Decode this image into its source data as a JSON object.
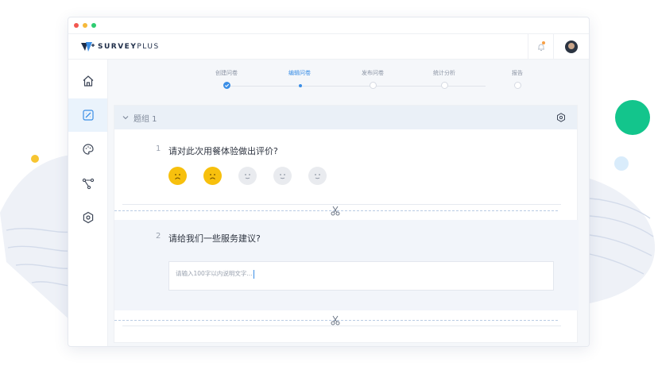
{
  "app": {
    "logo_text": "SURVEY",
    "logo_plus": "PLUS"
  },
  "colors": {
    "accent": "#3a8ee6",
    "face_active": "#f7c00d",
    "decor_green": "#13c58c",
    "decor_yellow": "#f7c531"
  },
  "sidebar": {
    "items": [
      {
        "icon": "home-icon"
      },
      {
        "icon": "edit-survey-icon",
        "active": true
      },
      {
        "icon": "palette-icon"
      },
      {
        "icon": "flow-icon"
      },
      {
        "icon": "settings-icon"
      }
    ]
  },
  "steps": [
    {
      "label": "创建问卷",
      "state": "done"
    },
    {
      "label": "编辑问卷",
      "state": "current"
    },
    {
      "label": "发布问卷",
      "state": "todo"
    },
    {
      "label": "统计分析",
      "state": "todo"
    },
    {
      "label": "报告",
      "state": "todo"
    }
  ],
  "group": {
    "title": "题组 1"
  },
  "questions": [
    {
      "number": "1",
      "text": "请对此次用餐体验做出评价?",
      "rating_selected": 2,
      "rating_max": 5
    },
    {
      "number": "2",
      "text": "请给我们一些服务建议?",
      "placeholder": "请输入100字以内说明文字..."
    }
  ]
}
